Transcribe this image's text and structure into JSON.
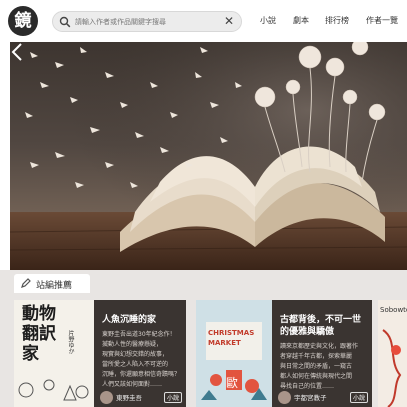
{
  "header": {
    "logo_char": "鏡",
    "search": {
      "placeholder": "請輸入作者或作品關鍵字搜尋",
      "value": ""
    },
    "nav": [
      "小說",
      "劇本",
      "排行榜",
      "作者一覽"
    ]
  },
  "banner": {
    "icons": [
      "chevron-left-icon"
    ]
  },
  "editors_pick": {
    "label": "站編推薦",
    "cards": [
      {
        "cover_text": [
          "動",
          "物",
          "翻",
          "訳",
          "家"
        ],
        "cover_small": "片野ゆか",
        "title": "人魚沉睡的家",
        "desc": [
          "東野圭吾出道30年紀念作！",
          "揻動人性的醫療懸疑，",
          "現實與幻想交錯的故事，",
          "當所愛之人陷入不可逆的",
          "沉睡，你還願意相信奇蹟嗎？",
          "人們又該如何面對……"
        ],
        "author": "東野圭吾",
        "badge": "小說"
      },
      {
        "cover_text": [
          "CHRISTMAS",
          "MARKET"
        ],
        "cover_small": "歐",
        "title": "古都背後，不可一世的優雅與驕傲",
        "desc": [
          "讀來京都歷史與文化，跟著作",
          "者穿越千年古都，探索華麗",
          "與日常之間的矛盾，一窺古",
          "都人如何在傳統與現代之間",
          "尋找自己的位置……"
        ],
        "author": "宇都宮教子",
        "badge": "小說"
      },
      {
        "cover_text": [
          "Sobowtór"
        ]
      }
    ]
  },
  "colors": {
    "card_bg": "#3a3431",
    "section_bg": "#e8e5e3",
    "logo_bg": "#2b2b2b"
  }
}
